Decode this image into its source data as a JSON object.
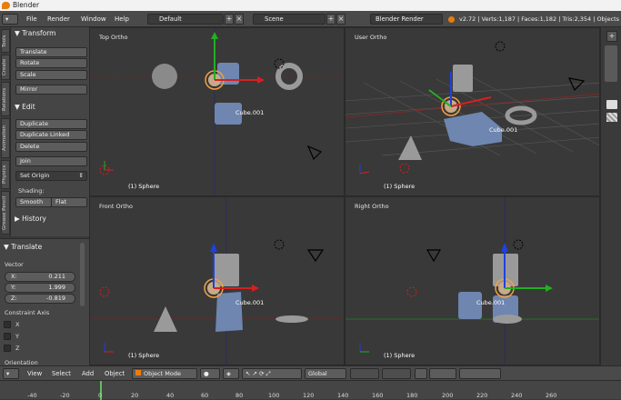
{
  "window": {
    "title": "Blender"
  },
  "menu": {
    "items": [
      "File",
      "Render",
      "Window",
      "Help"
    ]
  },
  "layout_selector": {
    "value": "Default"
  },
  "scene_selector": {
    "value": "Scene"
  },
  "engine_selector": {
    "value": "Blender Render"
  },
  "stats": {
    "text": "v2.72 | Verts:1,187 | Faces:1,182 | Tris:2,354 | Objects"
  },
  "tool_tabs": [
    "Tools",
    "Create",
    "Relations",
    "Animation",
    "Physics",
    "Grease Pencil"
  ],
  "tools": {
    "transform_header": "Transform",
    "translate": "Translate",
    "rotate": "Rotate",
    "scale": "Scale",
    "mirror": "Mirror",
    "edit_header": "Edit",
    "duplicate": "Duplicate",
    "duplicate_linked": "Duplicate Linked",
    "delete": "Delete",
    "join": "Join",
    "set_origin": "Set Origin",
    "shading_label": "Shading:",
    "smooth": "Smooth",
    "flat": "Flat",
    "history_header": "History"
  },
  "operator": {
    "header": "Translate",
    "vector_label": "Vector",
    "x_label": "X:",
    "x_value": "0.211",
    "y_label": "Y:",
    "y_value": "1.999",
    "z_label": "Z:",
    "z_value": "-0.819",
    "constraint_label": "Constraint Axis",
    "axis_x": "X",
    "axis_y": "Y",
    "axis_z": "Z",
    "orientation_label": "Orientation"
  },
  "viewports": [
    {
      "name": "Top Ortho",
      "footer": "(1) Sphere",
      "label": "Cube.001"
    },
    {
      "name": "User Ortho",
      "footer": "(1) Sphere",
      "label": "Cube.001"
    },
    {
      "name": "Front Ortho",
      "footer": "(1) Sphere",
      "label": "Cube.001"
    },
    {
      "name": "Right Ortho",
      "footer": "(1) Sphere",
      "label": "Cube.001"
    }
  ],
  "header3d": {
    "view": "View",
    "select": "Select",
    "add": "Add",
    "object": "Object",
    "mode": "Object Mode",
    "orientation": "Global"
  },
  "timeline": {
    "ticks": [
      "-40",
      "-20",
      "0",
      "20",
      "40",
      "60",
      "80",
      "100",
      "120",
      "140",
      "160",
      "180",
      "200",
      "220",
      "240",
      "260"
    ]
  },
  "colors": {
    "accent": "#e87d0d",
    "axis_red": "#d62020",
    "axis_green": "#20b020",
    "axis_blue": "#2040e0",
    "object": "#6e86b0",
    "select": "#f0a040"
  }
}
